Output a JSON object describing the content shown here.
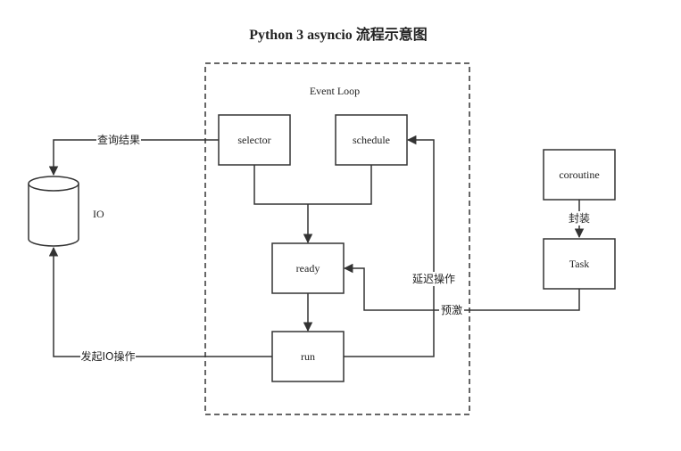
{
  "title": "Python 3 asyncio 流程示意图",
  "event_loop_label": "Event Loop",
  "nodes": {
    "selector": "selector",
    "schedule": "schedule",
    "ready": "ready",
    "run": "run",
    "io": "IO",
    "coroutine": "coroutine",
    "task": "Task"
  },
  "edge_labels": {
    "query_result": "查询结果",
    "start_io": "发起IO操作",
    "delay": "延迟操作",
    "prime": "预激",
    "wrap": "封装"
  },
  "colors": {
    "stroke": "#333333",
    "text": "#222222",
    "background": "#ffffff"
  }
}
